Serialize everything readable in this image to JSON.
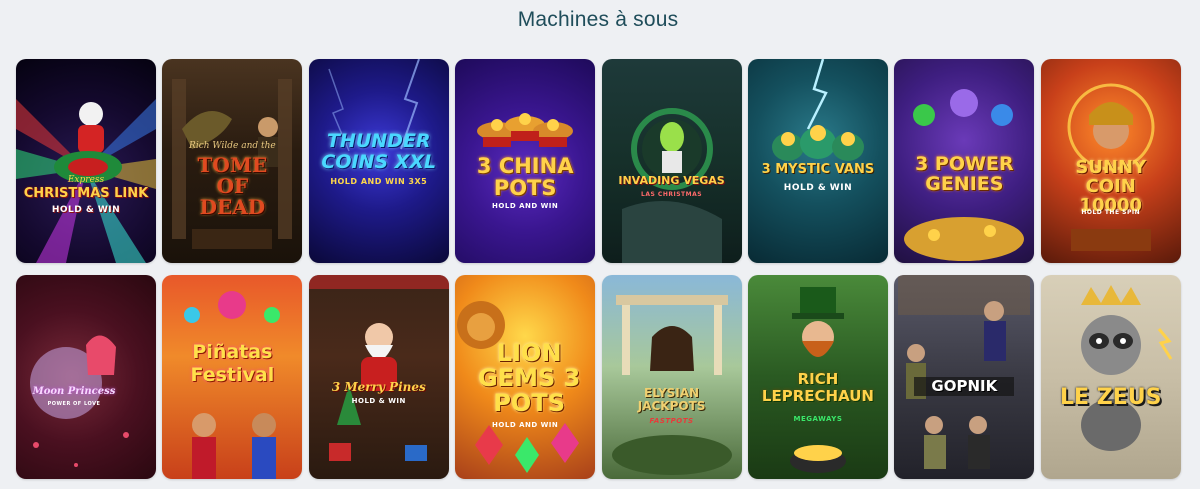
{
  "section": {
    "title": "Machines à sous"
  },
  "games": [
    {
      "logo": "Christmas Link",
      "small": "Express",
      "sub": "Hold & Win"
    },
    {
      "logo": "Tome of Dead",
      "small": "Rich Wilde and the",
      "sub": ""
    },
    {
      "logo": "Thunder Coins XXL",
      "small": "",
      "sub": "Hold and Win 3x5"
    },
    {
      "logo": "3 China Pots",
      "small": "",
      "sub": "Hold and Win"
    },
    {
      "logo": "Invading Vegas",
      "small": "",
      "sub": "Las Christmas"
    },
    {
      "logo": "3 Mystic Vans",
      "small": "",
      "sub": "Hold & Win"
    },
    {
      "logo": "3 Power Genies",
      "small": "",
      "sub": ""
    },
    {
      "logo": "Sunny Coin 10000",
      "small": "",
      "sub": "Hold the Spin"
    },
    {
      "logo": "Moon Princess",
      "small": "",
      "sub": "Power of Love"
    },
    {
      "logo": "Piñatas Festival",
      "small": "",
      "sub": ""
    },
    {
      "logo": "3 Merry Pines",
      "small": "",
      "sub": "Hold & Win"
    },
    {
      "logo": "Lion Gems 3 Pots",
      "small": "",
      "sub": "Hold and Win"
    },
    {
      "logo": "Elysian Jackpots",
      "small": "",
      "sub": "Fastpots"
    },
    {
      "logo": "Rich Leprechaun",
      "small": "",
      "sub": "Megaways"
    },
    {
      "logo": "Gopnik",
      "small": "",
      "sub": ""
    },
    {
      "logo": "Le Zeus",
      "small": "",
      "sub": ""
    }
  ],
  "colors": {
    "page_bg": "#eef0f3",
    "heading": "#1f4d5a"
  }
}
